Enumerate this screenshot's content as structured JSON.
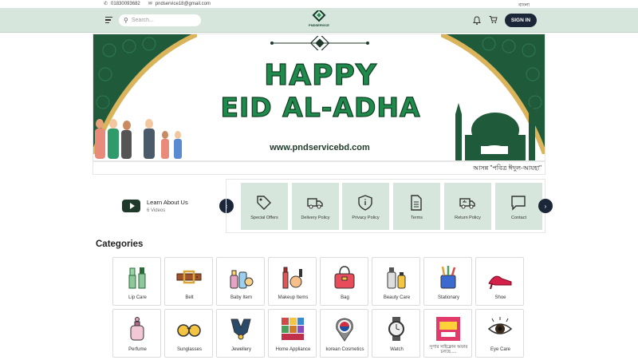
{
  "topbar": {
    "phone": "01830093682",
    "email": "pndservice18@gmail.com",
    "language": "বাংলা"
  },
  "header": {
    "search_placeholder": "Search...",
    "logo_text": "PNDSERVICE",
    "signin_label": "SIGN IN"
  },
  "banner": {
    "headline_1": "HAPPY",
    "headline_2": "EID AL-ADHA",
    "url": "www.pndservicebd.com",
    "marquee": "আসন্ন \"পবিত্র ঈদুল-আযহা\""
  },
  "learn": {
    "title": "Learn About Us",
    "count": "6 Videos"
  },
  "policies": [
    {
      "label": "Special Offers",
      "icon": "tag-icon"
    },
    {
      "label": "Delivery Policy",
      "icon": "truck-icon"
    },
    {
      "label": "Privacy Policy",
      "icon": "shield-icon"
    },
    {
      "label": "Terms",
      "icon": "document-icon"
    },
    {
      "label": "Return Policy",
      "icon": "return-truck-icon"
    },
    {
      "label": "Contact",
      "icon": "chat-icon"
    }
  ],
  "categories_title": "Categories",
  "categories": [
    {
      "label": "Lip Care",
      "icon": "lipstick-icon"
    },
    {
      "label": "Belt",
      "icon": "belt-icon"
    },
    {
      "label": "Baby Item",
      "icon": "baby-bottle-icon"
    },
    {
      "label": "Makeup Items",
      "icon": "makeup-icon"
    },
    {
      "label": "Bag",
      "icon": "handbag-icon"
    },
    {
      "label": "Beauty Care",
      "icon": "lotion-icon"
    },
    {
      "label": "Stationary",
      "icon": "pencil-cup-icon"
    },
    {
      "label": "Shoe",
      "icon": "high-heel-icon"
    },
    {
      "label": "Perfume",
      "icon": "perfume-icon"
    },
    {
      "label": "Sunglasses",
      "icon": "sunglasses-icon"
    },
    {
      "label": "Jewellery",
      "icon": "necklace-icon"
    },
    {
      "label": "Home Appliance",
      "icon": "appliance-icon"
    },
    {
      "label": "korean Cosmetics",
      "icon": "korea-pin-icon"
    },
    {
      "label": "Watch",
      "icon": "watch-icon"
    },
    {
      "label": "সুপার সাইক্লোন অফার চলছে.....",
      "icon": "offer-banner-icon"
    },
    {
      "label": "Eye Care",
      "icon": "eye-icon"
    }
  ],
  "colors": {
    "header_bg": "#d7e6dc",
    "primary_dark": "#1b2638",
    "accent_green": "#1f8a4c",
    "policy_bg": "#d7e6dc"
  }
}
